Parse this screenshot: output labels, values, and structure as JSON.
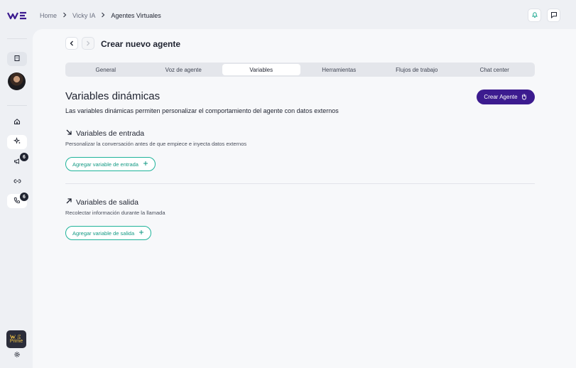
{
  "header": {
    "logo": "WE",
    "breadcrumb": [
      "Home",
      "Vicky IA",
      "Agentes Virtuales"
    ],
    "icons": [
      "bell-icon",
      "chat-icon"
    ]
  },
  "sidebar": {
    "prime_logo": "WE",
    "prime_label": "Prime",
    "badges": {
      "campaigns": "6",
      "calls": "6"
    }
  },
  "page": {
    "title": "Crear nuevo agente",
    "tabs": [
      {
        "label": "General",
        "active": false
      },
      {
        "label": "Voz de agente",
        "active": false
      },
      {
        "label": "Variables",
        "active": true
      },
      {
        "label": "Herramientas",
        "active": false
      },
      {
        "label": "Flujos de trabajo",
        "active": false
      },
      {
        "label": "Chat center",
        "active": false
      }
    ],
    "section_title": "Variables dinámicas",
    "section_desc": "Las variables dinámicas permiten personalizar el comportamiento del agente con datos externos",
    "create_button": "Crear Agente",
    "input": {
      "title": "Variables de entrada",
      "desc": "Personalizar la conversación antes de que empiece e inyecta datos externos",
      "button": "Agregar variable de entrada"
    },
    "output": {
      "title": "Variables de salida",
      "desc": "Recolectar información durante la llamada",
      "button": "Agregar variable de salida"
    }
  },
  "colors": {
    "accent": "#3c1b8f",
    "teal": "#1fb39a",
    "background": "#eef0f4",
    "panel": "#f7f8fa"
  }
}
